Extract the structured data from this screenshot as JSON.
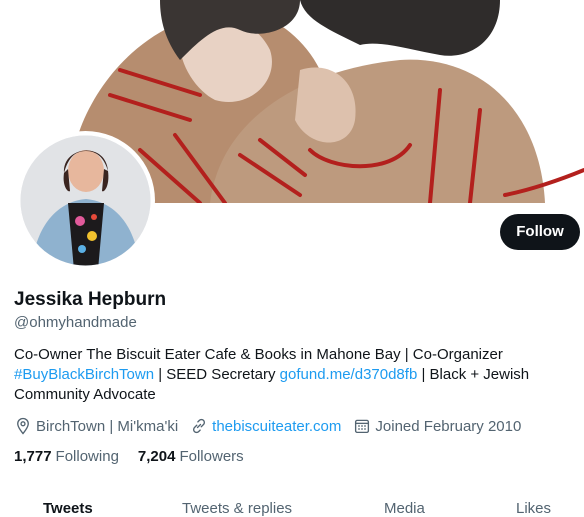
{
  "profile": {
    "follow_label": "Follow",
    "name": "Jessika Hepburn",
    "handle": "@ohmyhandmade",
    "bio": {
      "part1": "Co-Owner The Biscuit Eater Cafe & Books in Mahone Bay | Co-Organizer ",
      "hashtag": "#BuyBlackBirchTown",
      "part2": " | SEED Secretary ",
      "link": "gofund.me/d370d8fb",
      "part3": " | Black + Jewish Community Advocate"
    },
    "location": "BirchTown | Mi'kma'ki",
    "website": "thebiscuiteater.com",
    "joined": "Joined February 2010",
    "following_count": "1,777",
    "following_label": "Following",
    "followers_count": "7,204",
    "followers_label": "Followers"
  },
  "tabs": [
    "Tweets",
    "Tweets & replies",
    "Media",
    "Likes"
  ],
  "icons": {
    "location": "location-pin-icon",
    "link": "link-icon",
    "calendar": "calendar-icon"
  },
  "colors": {
    "accent": "#1d9bf0",
    "text": "#0f1419",
    "muted": "#536471",
    "follow_bg": "#0f1419"
  }
}
